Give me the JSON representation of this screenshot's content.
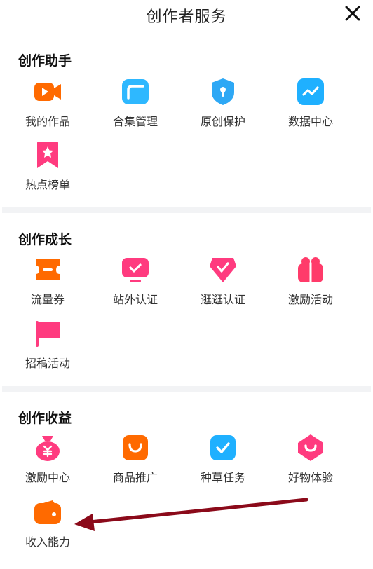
{
  "header": {
    "title": "创作者服务",
    "close_icon": "close-icon"
  },
  "sections": [
    {
      "title": "创作助手",
      "items": [
        {
          "label": "我的作品",
          "icon": "video-camera-icon",
          "color": "#FF6A00"
        },
        {
          "label": "合集管理",
          "icon": "folder-icon",
          "color": "#2EB8FF"
        },
        {
          "label": "原创保护",
          "icon": "shield-lock-icon",
          "color": "#2EA8F5"
        },
        {
          "label": "数据中心",
          "icon": "trend-chart-icon",
          "color": "#1FB0FF"
        },
        {
          "label": "热点榜单",
          "icon": "bookmark-star-icon",
          "color": "#FF3B7F"
        }
      ]
    },
    {
      "title": "创作成长",
      "items": [
        {
          "label": "流量券",
          "icon": "ticket-icon",
          "color": "#FF6A00"
        },
        {
          "label": "站外认证",
          "icon": "monitor-check-icon",
          "color": "#FF3B7F"
        },
        {
          "label": "逛逛认证",
          "icon": "diamond-check-icon",
          "color": "#FF3B7F"
        },
        {
          "label": "激励活动",
          "icon": "gift-icon",
          "color": "#FF3B6A"
        },
        {
          "label": "招稿活动",
          "icon": "flag-icon",
          "color": "#FF3B7F"
        }
      ]
    },
    {
      "title": "创作收益",
      "items": [
        {
          "label": "激励中心",
          "icon": "money-bag-icon",
          "color": "#FF3B7F"
        },
        {
          "label": "商品推广",
          "icon": "shopping-bag-icon",
          "color": "#FF6A00"
        },
        {
          "label": "种草任务",
          "icon": "check-badge-icon",
          "color": "#1FB0FF"
        },
        {
          "label": "好物体验",
          "icon": "gift-box-icon",
          "color": "#FF3B7F"
        },
        {
          "label": "收入能力",
          "icon": "wallet-icon",
          "color": "#FF6A00"
        }
      ]
    }
  ],
  "annotation": {
    "arrow_color": "#8B0A1A"
  }
}
